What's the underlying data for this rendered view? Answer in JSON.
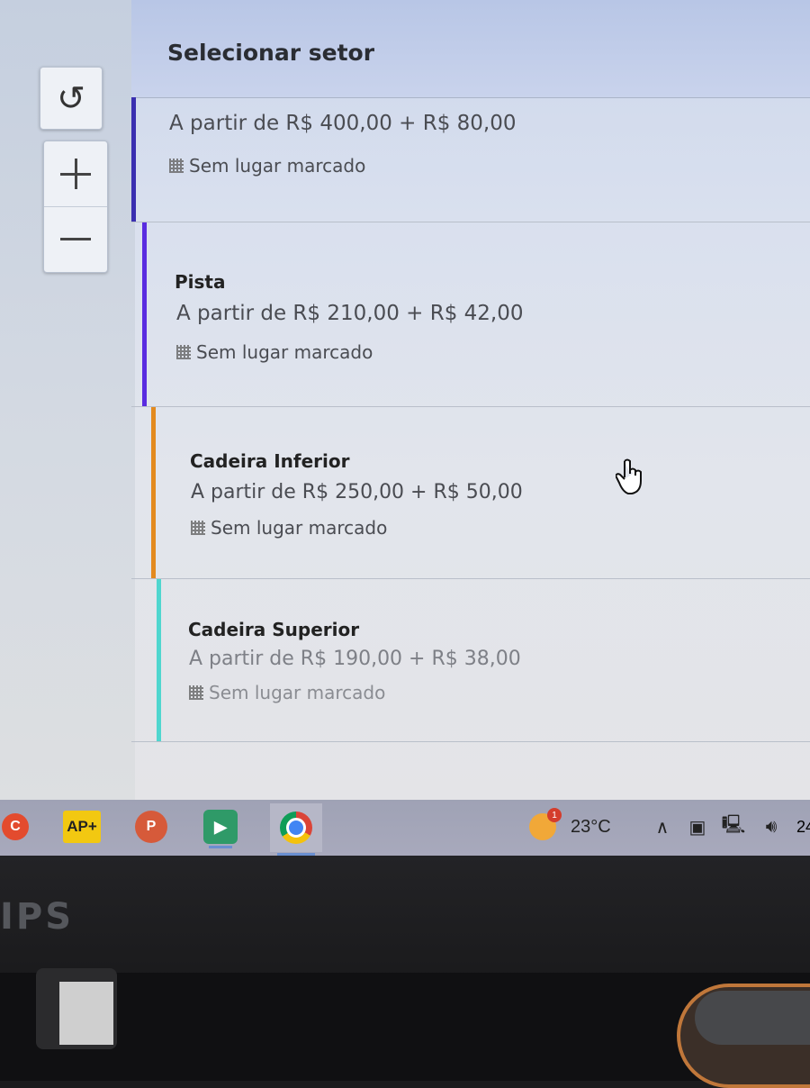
{
  "panel": {
    "title": "Selecionar setor"
  },
  "map_controls": {
    "reset_icon": "rotate-ccw-icon",
    "zoom_in_icon": "plus-icon",
    "zoom_out_icon": "minus-icon"
  },
  "sectors": [
    {
      "name": "",
      "price": "A partir de R$ 400,00 + R$ 80,00",
      "seat_info": "Sem lugar marcado",
      "color": "#3a2fb0"
    },
    {
      "name": "Pista",
      "price": "A partir de R$ 210,00 + R$ 42,00",
      "seat_info": "Sem lugar marcado",
      "color": "#5a2ce0"
    },
    {
      "name": "Cadeira Inferior",
      "price": "A partir de R$ 250,00 + R$ 50,00",
      "seat_info": "Sem lugar marcado",
      "color": "#e38a1f"
    },
    {
      "name": "Cadeira Superior",
      "price": "A partir de R$ 190,00 + R$ 38,00",
      "seat_info": "Sem lugar marcado",
      "color": "#4fd6cf"
    }
  ],
  "taskbar": {
    "ap_label": "AP+",
    "ppt_label": "P",
    "weather_temp": "23°C",
    "weather_badge": "1",
    "clock_partial": "24"
  },
  "monitor": {
    "brand_partial": "IPS"
  }
}
